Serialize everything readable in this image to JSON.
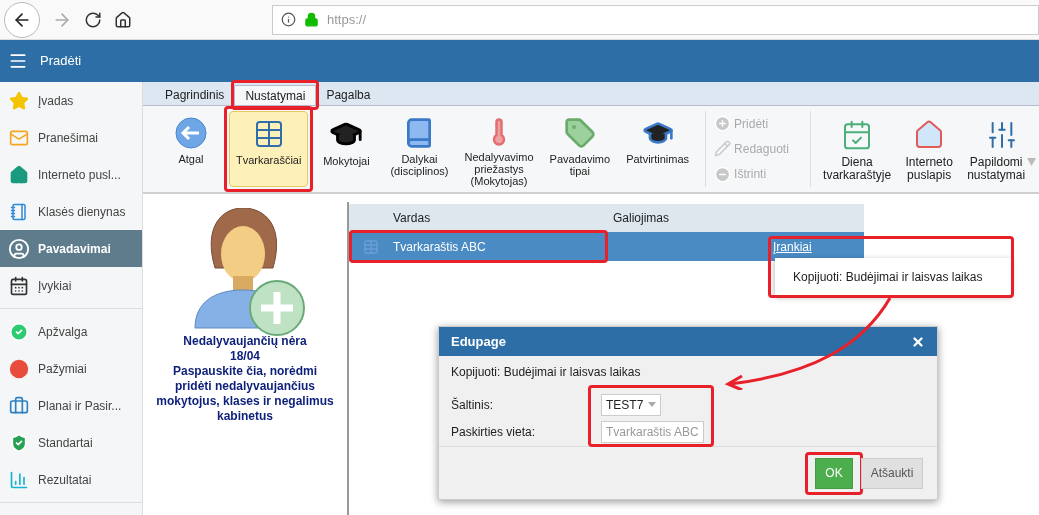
{
  "browser": {
    "url": "https://"
  },
  "header": {
    "title": "Pradėti"
  },
  "sidebar": {
    "groups": [
      [
        {
          "label": "Įvadas",
          "selected": false
        },
        {
          "label": "Pranešimai",
          "selected": false
        },
        {
          "label": "Interneto pusl...",
          "selected": false
        },
        {
          "label": "Klasės dienynas",
          "selected": false
        },
        {
          "label": "Pavadavimai",
          "selected": true
        },
        {
          "label": "Įvykiai",
          "selected": false
        }
      ],
      [
        {
          "label": "Apžvalga",
          "selected": false
        },
        {
          "label": "Pažymiai",
          "selected": false
        },
        {
          "label": "Planai ir Pasir...",
          "selected": false
        },
        {
          "label": "Standartai",
          "selected": false
        },
        {
          "label": "Rezultatai",
          "selected": false
        }
      ]
    ]
  },
  "ribbon": {
    "tabs": [
      {
        "label": "Pagrindinis",
        "selected": false
      },
      {
        "label": "Nustatymai",
        "selected": true,
        "highlighted": true
      },
      {
        "label": "Pagalba",
        "selected": false
      }
    ],
    "buttons": [
      {
        "label": "Atgal",
        "selected": false
      },
      {
        "label": "Tvarkaraščiai",
        "selected": true,
        "highlighted": true
      },
      {
        "label": "Mokytojai",
        "selected": false
      },
      {
        "label": "Dalykai\n(disciplinos)",
        "selected": false
      },
      {
        "label": "Nedalyvavimo\npriežastys\n(Mokytojas)",
        "selected": false
      },
      {
        "label": "Pavadavimo\ntipai",
        "selected": false
      },
      {
        "label": "Patvirtinimas",
        "selected": false
      }
    ],
    "actions": [
      {
        "label": "Pridėti",
        "disabled": true
      },
      {
        "label": "Redaguoti",
        "disabled": true
      },
      {
        "label": "Ištrinti",
        "disabled": true
      }
    ],
    "extra_buttons": [
      {
        "label": "Diena\ntvarkaraštyje",
        "dropdown": false
      },
      {
        "label": "Interneto\npuslapis",
        "dropdown": false
      },
      {
        "label": "Papildomi\nnustatymai",
        "dropdown": true
      }
    ]
  },
  "notice": {
    "title": "Nedalyvaujančių nėra",
    "date": "18/04",
    "message": "Paspauskite čia, norėdmi pridėti nedalyvaujančius mokytojus, klases ir negalimus kabinetus"
  },
  "table": {
    "columns": [
      "Vardas",
      "Galiojimas"
    ],
    "rows": [
      {
        "name": "Tvarkaraštis ABC",
        "link": "Įrankiai",
        "selected": true,
        "highlighted": true
      }
    ]
  },
  "menu": {
    "items": [
      "Kopijuoti: Budėjimai ir laisvas laikas"
    ],
    "highlighted": true
  },
  "annotation_arrow": true,
  "dialog": {
    "title": "Edupage",
    "message": "Kopijuoti: Budėjimai ir laisvas laikas",
    "fields_highlighted": true,
    "fields": [
      {
        "label": "Šaltinis:",
        "kind": "select",
        "value": "TEST7"
      },
      {
        "label": "Paskirties vieta:",
        "kind": "text",
        "placeholder": "Tvarkaraštis ABC"
      }
    ],
    "buttons": [
      {
        "label": "OK",
        "kind": "primary",
        "highlighted": true
      },
      {
        "label": "Atšaukti",
        "kind": "secondary"
      }
    ]
  }
}
